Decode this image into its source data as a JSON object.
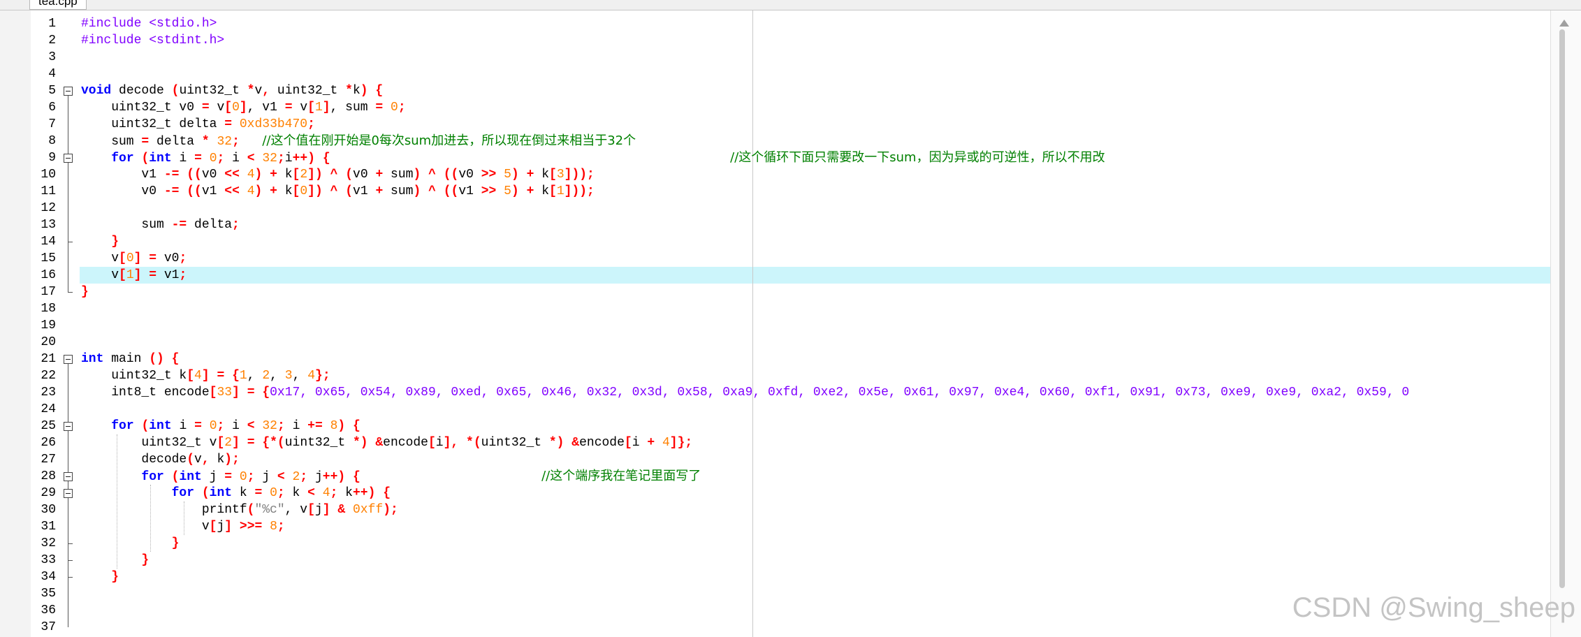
{
  "tab": {
    "label": "tea.cpp"
  },
  "lines": [
    {
      "n": "1",
      "tokens": [
        {
          "t": "#include <stdio.h>",
          "c": "pp"
        }
      ]
    },
    {
      "n": "2",
      "tokens": [
        {
          "t": "#include <stdint.h>",
          "c": "pp"
        }
      ]
    },
    {
      "n": "3",
      "tokens": []
    },
    {
      "n": "4",
      "tokens": []
    },
    {
      "n": "5",
      "tokens": [
        {
          "t": "void",
          "c": "kw"
        },
        {
          "t": " decode "
        },
        {
          "t": "(",
          "c": "op"
        },
        {
          "t": "uint32_t "
        },
        {
          "t": "*",
          "c": "op"
        },
        {
          "t": "v"
        },
        {
          "t": ",",
          "c": "op"
        },
        {
          "t": " uint32_t "
        },
        {
          "t": "*",
          "c": "op"
        },
        {
          "t": "k"
        },
        {
          "t": ")",
          "c": "op"
        },
        {
          "t": " "
        },
        {
          "t": "{",
          "c": "op"
        }
      ]
    },
    {
      "n": "6",
      "tokens": [
        {
          "t": "    uint32_t v0 "
        },
        {
          "t": "=",
          "c": "op"
        },
        {
          "t": " v"
        },
        {
          "t": "[",
          "c": "op"
        },
        {
          "t": "0",
          "c": "num"
        },
        {
          "t": "]",
          "c": "op"
        },
        {
          "t": ","
        },
        {
          "t": " v1 "
        },
        {
          "t": "=",
          "c": "op"
        },
        {
          "t": " v"
        },
        {
          "t": "[",
          "c": "op"
        },
        {
          "t": "1",
          "c": "num"
        },
        {
          "t": "]",
          "c": "op"
        },
        {
          "t": ", sum "
        },
        {
          "t": "=",
          "c": "op"
        },
        {
          "t": " "
        },
        {
          "t": "0",
          "c": "num"
        },
        {
          "t": ";",
          "c": "op"
        }
      ]
    },
    {
      "n": "7",
      "tokens": [
        {
          "t": "    uint32_t delta "
        },
        {
          "t": "=",
          "c": "op"
        },
        {
          "t": " "
        },
        {
          "t": "0xd33b470",
          "c": "num"
        },
        {
          "t": ";",
          "c": "op"
        }
      ]
    },
    {
      "n": "8",
      "tokens": [
        {
          "t": "    sum "
        },
        {
          "t": "=",
          "c": "op"
        },
        {
          "t": " delta "
        },
        {
          "t": "*",
          "c": "op"
        },
        {
          "t": " "
        },
        {
          "t": "32",
          "c": "num"
        },
        {
          "t": ";",
          "c": "op"
        },
        {
          "t": "   "
        },
        {
          "t": "//这个值在刚开始是0每次sum加进去，所以现在倒过来相当于32个",
          "c": "cm"
        }
      ]
    },
    {
      "n": "9",
      "tokens": [
        {
          "t": "    "
        },
        {
          "t": "for",
          "c": "kw"
        },
        {
          "t": " "
        },
        {
          "t": "(",
          "c": "op"
        },
        {
          "t": "int",
          "c": "kw"
        },
        {
          "t": " i "
        },
        {
          "t": "=",
          "c": "op"
        },
        {
          "t": " "
        },
        {
          "t": "0",
          "c": "num"
        },
        {
          "t": ";",
          "c": "op"
        },
        {
          "t": " i "
        },
        {
          "t": "<",
          "c": "op"
        },
        {
          "t": " "
        },
        {
          "t": "32",
          "c": "num"
        },
        {
          "t": ";",
          "c": "op"
        },
        {
          "t": "i"
        },
        {
          "t": "++",
          "c": "op"
        },
        {
          "t": ")",
          "c": "op"
        },
        {
          "t": " "
        },
        {
          "t": "{",
          "c": "op"
        },
        {
          "t": "                                                     "
        },
        {
          "t": "//这个循环下面只需要改一下sum，因为异或的可逆性，所以不用改",
          "c": "cm"
        }
      ]
    },
    {
      "n": "10",
      "tokens": [
        {
          "t": "        v1 "
        },
        {
          "t": "-=",
          "c": "op"
        },
        {
          "t": " "
        },
        {
          "t": "((",
          "c": "op"
        },
        {
          "t": "v0 "
        },
        {
          "t": "<<",
          "c": "op"
        },
        {
          "t": " "
        },
        {
          "t": "4",
          "c": "num"
        },
        {
          "t": ")",
          "c": "op"
        },
        {
          "t": " "
        },
        {
          "t": "+",
          "c": "op"
        },
        {
          "t": " k"
        },
        {
          "t": "[",
          "c": "op"
        },
        {
          "t": "2",
          "c": "num"
        },
        {
          "t": "])",
          "c": "op"
        },
        {
          "t": " "
        },
        {
          "t": "^",
          "c": "op"
        },
        {
          "t": " "
        },
        {
          "t": "(",
          "c": "op"
        },
        {
          "t": "v0 "
        },
        {
          "t": "+",
          "c": "op"
        },
        {
          "t": " sum"
        },
        {
          "t": ")",
          "c": "op"
        },
        {
          "t": " "
        },
        {
          "t": "^",
          "c": "op"
        },
        {
          "t": " "
        },
        {
          "t": "((",
          "c": "op"
        },
        {
          "t": "v0 "
        },
        {
          "t": ">>",
          "c": "op"
        },
        {
          "t": " "
        },
        {
          "t": "5",
          "c": "num"
        },
        {
          "t": ")",
          "c": "op"
        },
        {
          "t": " "
        },
        {
          "t": "+",
          "c": "op"
        },
        {
          "t": " k"
        },
        {
          "t": "[",
          "c": "op"
        },
        {
          "t": "3",
          "c": "num"
        },
        {
          "t": "]));",
          "c": "op"
        }
      ]
    },
    {
      "n": "11",
      "tokens": [
        {
          "t": "        v0 "
        },
        {
          "t": "-=",
          "c": "op"
        },
        {
          "t": " "
        },
        {
          "t": "((",
          "c": "op"
        },
        {
          "t": "v1 "
        },
        {
          "t": "<<",
          "c": "op"
        },
        {
          "t": " "
        },
        {
          "t": "4",
          "c": "num"
        },
        {
          "t": ")",
          "c": "op"
        },
        {
          "t": " "
        },
        {
          "t": "+",
          "c": "op"
        },
        {
          "t": " k"
        },
        {
          "t": "[",
          "c": "op"
        },
        {
          "t": "0",
          "c": "num"
        },
        {
          "t": "])",
          "c": "op"
        },
        {
          "t": " "
        },
        {
          "t": "^",
          "c": "op"
        },
        {
          "t": " "
        },
        {
          "t": "(",
          "c": "op"
        },
        {
          "t": "v1 "
        },
        {
          "t": "+",
          "c": "op"
        },
        {
          "t": " sum"
        },
        {
          "t": ")",
          "c": "op"
        },
        {
          "t": " "
        },
        {
          "t": "^",
          "c": "op"
        },
        {
          "t": " "
        },
        {
          "t": "((",
          "c": "op"
        },
        {
          "t": "v1 "
        },
        {
          "t": ">>",
          "c": "op"
        },
        {
          "t": " "
        },
        {
          "t": "5",
          "c": "num"
        },
        {
          "t": ")",
          "c": "op"
        },
        {
          "t": " "
        },
        {
          "t": "+",
          "c": "op"
        },
        {
          "t": " k"
        },
        {
          "t": "[",
          "c": "op"
        },
        {
          "t": "1",
          "c": "num"
        },
        {
          "t": "]));",
          "c": "op"
        }
      ]
    },
    {
      "n": "12",
      "tokens": []
    },
    {
      "n": "13",
      "tokens": [
        {
          "t": "        sum "
        },
        {
          "t": "-=",
          "c": "op"
        },
        {
          "t": " delta"
        },
        {
          "t": ";",
          "c": "op"
        }
      ]
    },
    {
      "n": "14",
      "tokens": [
        {
          "t": "    "
        },
        {
          "t": "}",
          "c": "op"
        }
      ]
    },
    {
      "n": "15",
      "tokens": [
        {
          "t": "    v"
        },
        {
          "t": "[",
          "c": "op"
        },
        {
          "t": "0",
          "c": "num"
        },
        {
          "t": "]",
          "c": "op"
        },
        {
          "t": " "
        },
        {
          "t": "=",
          "c": "op"
        },
        {
          "t": " v0"
        },
        {
          "t": ";",
          "c": "op"
        }
      ]
    },
    {
      "n": "16",
      "tokens": [
        {
          "t": "    v"
        },
        {
          "t": "[",
          "c": "op"
        },
        {
          "t": "1",
          "c": "num"
        },
        {
          "t": "]",
          "c": "op"
        },
        {
          "t": " "
        },
        {
          "t": "=",
          "c": "op"
        },
        {
          "t": " v1"
        },
        {
          "t": ";",
          "c": "op"
        }
      ]
    },
    {
      "n": "17",
      "tokens": [
        {
          "t": "}",
          "c": "op"
        }
      ]
    },
    {
      "n": "18",
      "tokens": []
    },
    {
      "n": "19",
      "tokens": []
    },
    {
      "n": "20",
      "tokens": []
    },
    {
      "n": "21",
      "tokens": [
        {
          "t": "int",
          "c": "kw"
        },
        {
          "t": " main "
        },
        {
          "t": "()",
          "c": "op"
        },
        {
          "t": " "
        },
        {
          "t": "{",
          "c": "op"
        }
      ]
    },
    {
      "n": "22",
      "tokens": [
        {
          "t": "    uint32_t k"
        },
        {
          "t": "[",
          "c": "op"
        },
        {
          "t": "4",
          "c": "num"
        },
        {
          "t": "]",
          "c": "op"
        },
        {
          "t": " "
        },
        {
          "t": "=",
          "c": "op"
        },
        {
          "t": " "
        },
        {
          "t": "{",
          "c": "op"
        },
        {
          "t": "1",
          "c": "num"
        },
        {
          "t": ","
        },
        {
          "t": " "
        },
        {
          "t": "2",
          "c": "num"
        },
        {
          "t": ", "
        },
        {
          "t": "3",
          "c": "num"
        },
        {
          "t": ", "
        },
        {
          "t": "4",
          "c": "num"
        },
        {
          "t": "};",
          "c": "op"
        }
      ]
    },
    {
      "n": "23",
      "tokens": [
        {
          "t": "    int8_t encode"
        },
        {
          "t": "[",
          "c": "op"
        },
        {
          "t": "33",
          "c": "num"
        },
        {
          "t": "]",
          "c": "op"
        },
        {
          "t": " "
        },
        {
          "t": "=",
          "c": "op"
        },
        {
          "t": " "
        },
        {
          "t": "{",
          "c": "op"
        },
        {
          "t": "0x17, 0x65, 0x54, 0x89, 0xed, 0x65, 0x46, 0x32, 0x3d, 0x58, 0xa9, 0xfd, 0xe2, 0x5e, 0x61, 0x97, 0xe4, 0x60, 0xf1, 0x91, 0x73, 0xe9, 0xe9, 0xa2, 0x59, 0",
          "c": "hex"
        }
      ]
    },
    {
      "n": "24",
      "tokens": []
    },
    {
      "n": "25",
      "tokens": [
        {
          "t": "    "
        },
        {
          "t": "for",
          "c": "kw"
        },
        {
          "t": " "
        },
        {
          "t": "(",
          "c": "op"
        },
        {
          "t": "int",
          "c": "kw"
        },
        {
          "t": " i "
        },
        {
          "t": "=",
          "c": "op"
        },
        {
          "t": " "
        },
        {
          "t": "0",
          "c": "num"
        },
        {
          "t": ";",
          "c": "op"
        },
        {
          "t": " i "
        },
        {
          "t": "<",
          "c": "op"
        },
        {
          "t": " "
        },
        {
          "t": "32",
          "c": "num"
        },
        {
          "t": ";",
          "c": "op"
        },
        {
          "t": " i "
        },
        {
          "t": "+=",
          "c": "op"
        },
        {
          "t": " "
        },
        {
          "t": "8",
          "c": "num"
        },
        {
          "t": ")",
          "c": "op"
        },
        {
          "t": " "
        },
        {
          "t": "{",
          "c": "op"
        }
      ]
    },
    {
      "n": "26",
      "tokens": [
        {
          "t": "        uint32_t v"
        },
        {
          "t": "[",
          "c": "op"
        },
        {
          "t": "2",
          "c": "num"
        },
        {
          "t": "]",
          "c": "op"
        },
        {
          "t": " "
        },
        {
          "t": "=",
          "c": "op"
        },
        {
          "t": " "
        },
        {
          "t": "{*(",
          "c": "op"
        },
        {
          "t": "uint32_t "
        },
        {
          "t": "*)",
          "c": "op"
        },
        {
          "t": " "
        },
        {
          "t": "&",
          "c": "op"
        },
        {
          "t": "encode"
        },
        {
          "t": "[",
          "c": "op"
        },
        {
          "t": "i"
        },
        {
          "t": "],",
          "c": "op"
        },
        {
          "t": " "
        },
        {
          "t": "*(",
          "c": "op"
        },
        {
          "t": "uint32_t "
        },
        {
          "t": "*)",
          "c": "op"
        },
        {
          "t": " "
        },
        {
          "t": "&",
          "c": "op"
        },
        {
          "t": "encode"
        },
        {
          "t": "[",
          "c": "op"
        },
        {
          "t": "i "
        },
        {
          "t": "+",
          "c": "op"
        },
        {
          "t": " "
        },
        {
          "t": "4",
          "c": "num"
        },
        {
          "t": "]};",
          "c": "op"
        }
      ]
    },
    {
      "n": "27",
      "tokens": [
        {
          "t": "        decode"
        },
        {
          "t": "(",
          "c": "op"
        },
        {
          "t": "v"
        },
        {
          "t": ",",
          "c": "op"
        },
        {
          "t": " k"
        },
        {
          "t": ");",
          "c": "op"
        }
      ]
    },
    {
      "n": "28",
      "tokens": [
        {
          "t": "        "
        },
        {
          "t": "for",
          "c": "kw"
        },
        {
          "t": " "
        },
        {
          "t": "(",
          "c": "op"
        },
        {
          "t": "int",
          "c": "kw"
        },
        {
          "t": " j "
        },
        {
          "t": "=",
          "c": "op"
        },
        {
          "t": " "
        },
        {
          "t": "0",
          "c": "num"
        },
        {
          "t": ";",
          "c": "op"
        },
        {
          "t": " j "
        },
        {
          "t": "<",
          "c": "op"
        },
        {
          "t": " "
        },
        {
          "t": "2",
          "c": "num"
        },
        {
          "t": ";",
          "c": "op"
        },
        {
          "t": " j"
        },
        {
          "t": "++",
          "c": "op"
        },
        {
          "t": ")",
          "c": "op"
        },
        {
          "t": " "
        },
        {
          "t": "{",
          "c": "op"
        },
        {
          "t": "                        "
        },
        {
          "t": "//这个端序我在笔记里面写了",
          "c": "cm"
        }
      ]
    },
    {
      "n": "29",
      "tokens": [
        {
          "t": "            "
        },
        {
          "t": "for",
          "c": "kw"
        },
        {
          "t": " "
        },
        {
          "t": "(",
          "c": "op"
        },
        {
          "t": "int",
          "c": "kw"
        },
        {
          "t": " k "
        },
        {
          "t": "=",
          "c": "op"
        },
        {
          "t": " "
        },
        {
          "t": "0",
          "c": "num"
        },
        {
          "t": ";",
          "c": "op"
        },
        {
          "t": " k "
        },
        {
          "t": "<",
          "c": "op"
        },
        {
          "t": " "
        },
        {
          "t": "4",
          "c": "num"
        },
        {
          "t": ";",
          "c": "op"
        },
        {
          "t": " k"
        },
        {
          "t": "++",
          "c": "op"
        },
        {
          "t": ")",
          "c": "op"
        },
        {
          "t": " "
        },
        {
          "t": "{",
          "c": "op"
        }
      ]
    },
    {
      "n": "30",
      "tokens": [
        {
          "t": "                printf"
        },
        {
          "t": "(",
          "c": "op"
        },
        {
          "t": "\"%c\"",
          "c": "str"
        },
        {
          "t": ","
        },
        {
          "t": " v"
        },
        {
          "t": "[",
          "c": "op"
        },
        {
          "t": "j"
        },
        {
          "t": "]",
          "c": "op"
        },
        {
          "t": " "
        },
        {
          "t": "&",
          "c": "op"
        },
        {
          "t": " "
        },
        {
          "t": "0xff",
          "c": "num"
        },
        {
          "t": ");",
          "c": "op"
        }
      ]
    },
    {
      "n": "31",
      "tokens": [
        {
          "t": "                v"
        },
        {
          "t": "[",
          "c": "op"
        },
        {
          "t": "j"
        },
        {
          "t": "]",
          "c": "op"
        },
        {
          "t": " "
        },
        {
          "t": ">>=",
          "c": "op"
        },
        {
          "t": " "
        },
        {
          "t": "8",
          "c": "num"
        },
        {
          "t": ";",
          "c": "op"
        }
      ]
    },
    {
      "n": "32",
      "tokens": [
        {
          "t": "            "
        },
        {
          "t": "}",
          "c": "op"
        }
      ]
    },
    {
      "n": "33",
      "tokens": [
        {
          "t": "        "
        },
        {
          "t": "}",
          "c": "op"
        }
      ]
    },
    {
      "n": "34",
      "tokens": [
        {
          "t": "    "
        },
        {
          "t": "}",
          "c": "op"
        }
      ]
    },
    {
      "n": "35",
      "tokens": []
    },
    {
      "n": "36",
      "tokens": []
    },
    {
      "n": "37",
      "tokens": []
    }
  ],
  "current_line": "16",
  "watermark": "CSDN @Swing_sheep"
}
